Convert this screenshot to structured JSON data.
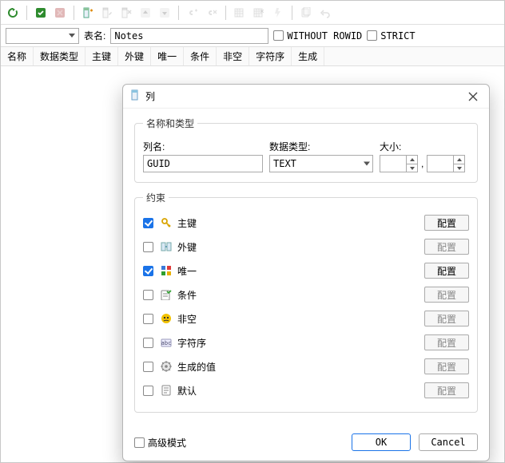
{
  "toolbar": {
    "table_label": "表名:",
    "table_value": "Notes",
    "without_rowid": "WITHOUT ROWID",
    "strict": "STRICT"
  },
  "columns_header": [
    "名称",
    "数据类型",
    "主键",
    "外键",
    "唯一",
    "条件",
    "非空",
    "字符序",
    "生成"
  ],
  "dialog": {
    "title": "列",
    "group_name_type": "名称和类型",
    "col_name_label": "列名:",
    "col_name_value": "GUID",
    "datatype_label": "数据类型:",
    "datatype_value": "TEXT",
    "size_label": "大小:",
    "size_sep": ",",
    "group_constraints": "约束",
    "constraints": [
      {
        "key": "pk",
        "label": "主键",
        "checked": true,
        "enabled": true
      },
      {
        "key": "fk",
        "label": "外键",
        "checked": false,
        "enabled": false
      },
      {
        "key": "uq",
        "label": "唯一",
        "checked": true,
        "enabled": true
      },
      {
        "key": "ck",
        "label": "条件",
        "checked": false,
        "enabled": false
      },
      {
        "key": "nn",
        "label": "非空",
        "checked": false,
        "enabled": false
      },
      {
        "key": "co",
        "label": "字符序",
        "checked": false,
        "enabled": false
      },
      {
        "key": "gn",
        "label": "生成的值",
        "checked": false,
        "enabled": false
      },
      {
        "key": "df",
        "label": "默认",
        "checked": false,
        "enabled": false
      }
    ],
    "configure": "配置",
    "advanced": "高级模式",
    "ok": "OK",
    "cancel": "Cancel"
  },
  "icons": {
    "refresh": "refresh",
    "commit": "commit",
    "rollback": "rollback",
    "add_col": "add-column",
    "ins_col": "insert-column",
    "del_col": "delete-column",
    "up": "move-up",
    "down": "move-down",
    "link": "link",
    "attach": "attach",
    "grid1": "grid1",
    "grid2": "grid2",
    "ddl": "ddl",
    "copy": "copy",
    "undo": "undo"
  }
}
